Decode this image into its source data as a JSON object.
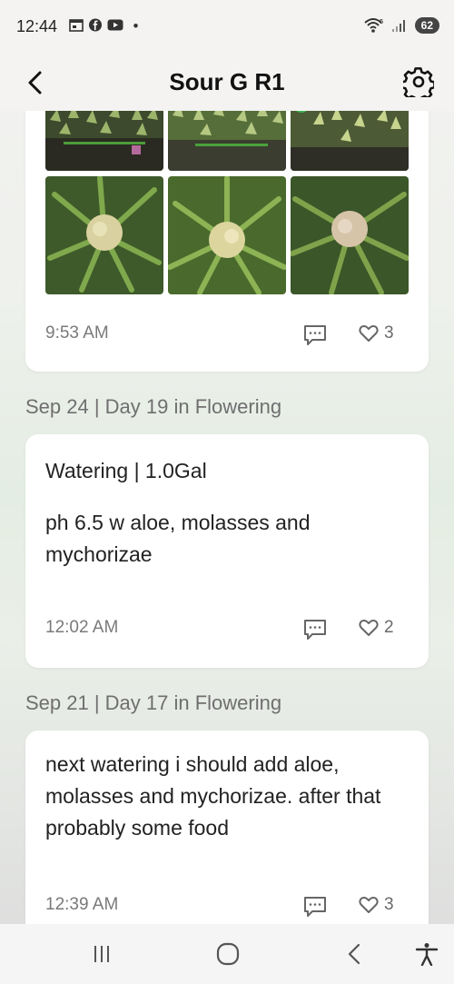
{
  "status_bar": {
    "time": "12:44",
    "battery": "62",
    "icons": [
      "calendar-icon",
      "facebook-icon",
      "youtube-icon",
      "dot-icon",
      "wifi-icon",
      "signal-icon"
    ]
  },
  "header": {
    "title": "Sour G R1",
    "back_icon": "chevron-left-icon",
    "settings_icon": "gear-icon"
  },
  "posts": [
    {
      "time": "9:53 AM",
      "likes": "3",
      "photos": [
        "plant-canopy",
        "plant-canopy",
        "plant-canopy",
        "plant-bud",
        "plant-bud",
        "plant-bud"
      ]
    },
    {
      "date_header": "Sep 24 | Day 19 in Flowering",
      "title": "Watering | 1.0Gal",
      "body": "ph 6.5 w aloe, molasses and mychorizae",
      "time": "12:02 AM",
      "likes": "2"
    },
    {
      "date_header": "Sep 21 | Day 17 in Flowering",
      "body": "next watering i should add aloe, molasses and mychorizae. after that probably some food",
      "time": "12:39 AM",
      "likes": "3"
    }
  ],
  "nav": {
    "icons": [
      "recents-icon",
      "home-icon",
      "back-icon",
      "accessibility-icon"
    ]
  }
}
